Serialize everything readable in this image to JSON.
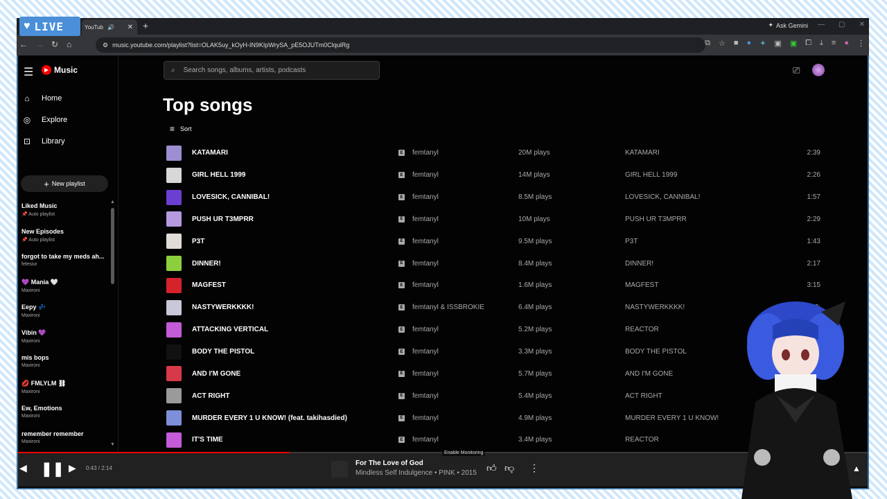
{
  "overlay": {
    "live_label": "LIVE"
  },
  "browser": {
    "tab_title": "YouTub",
    "url": "music.youtube.com/playlist?list=OLAK5uy_kOyH-IN9KIpWrySA_pE5OJUTm0ClqulRg",
    "ask_gemini": "Ask Gemini"
  },
  "app": {
    "brand": "Music",
    "search_placeholder": "Search songs, albums, artists, podcasts",
    "nav": [
      {
        "label": "Home",
        "icon": "home-icon"
      },
      {
        "label": "Explore",
        "icon": "explore-icon"
      },
      {
        "label": "Library",
        "icon": "library-icon"
      }
    ],
    "new_playlist_label": "New playlist",
    "playlists": [
      {
        "title": "Liked Music",
        "sub": "📌 Auto playlist"
      },
      {
        "title": "New Episodes",
        "sub": "📌 Auto playlist"
      },
      {
        "title": "forgot to take my meds ah...",
        "sub": "felesiur"
      },
      {
        "title": "💜 Mania 🤍",
        "sub": "Maxironi"
      },
      {
        "title": "Eepy 💤",
        "sub": "Maxironi"
      },
      {
        "title": "Vibin 💜",
        "sub": "Maxironi"
      },
      {
        "title": "mis bops",
        "sub": "Maxironi"
      },
      {
        "title": "💋 FMLYLM ⛓",
        "sub": "Maxironi"
      },
      {
        "title": "Ew, Emotions",
        "sub": "Maxironi"
      },
      {
        "title": "remember remember",
        "sub": "Maxironi"
      }
    ],
    "page_title": "Top songs",
    "sort_label": "Sort",
    "explicit_badge": "E",
    "songs": [
      {
        "title": "KATAMARI",
        "artist": "femtanyl",
        "plays": "20M plays",
        "album": "KATAMARI",
        "duration": "2:39",
        "color": "#9c8ed1"
      },
      {
        "title": "GIRL HELL 1999",
        "artist": "femtanyl",
        "plays": "14M plays",
        "album": "GIRL HELL 1999",
        "duration": "2:26",
        "color": "#d8d8d8"
      },
      {
        "title": "LOVESICK, CANNIBAL!",
        "artist": "femtanyl",
        "plays": "8.5M plays",
        "album": "LOVESICK, CANNIBAL!",
        "duration": "1:57",
        "color": "#6a3fd1"
      },
      {
        "title": "PUSH UR T3MPRR",
        "artist": "femtanyl",
        "plays": "10M plays",
        "album": "PUSH UR T3MPRR",
        "duration": "2:29",
        "color": "#b59adf"
      },
      {
        "title": "P3T",
        "artist": "femtanyl",
        "plays": "9.5M plays",
        "album": "P3T",
        "duration": "1:43",
        "color": "#e0dcd6"
      },
      {
        "title": "DINNER!",
        "artist": "femtanyl",
        "plays": "8.4M plays",
        "album": "DINNER!",
        "duration": "2:17",
        "color": "#8ccf3e"
      },
      {
        "title": "MAGFEST",
        "artist": "femtanyl",
        "plays": "1.6M plays",
        "album": "MAGFEST",
        "duration": "3:15",
        "color": "#d6222a"
      },
      {
        "title": "NASTYWERKKKK!",
        "artist": "femtanyl & ISSBROKIE",
        "plays": "6.4M plays",
        "album": "NASTYWERKKKK!",
        "duration": "2:",
        "color": "#c8c8d8"
      },
      {
        "title": "ATTACKING VERTICAL",
        "artist": "femtanyl",
        "plays": "5.2M plays",
        "album": "REACTOR",
        "duration": "",
        "color": "#c45bd8"
      },
      {
        "title": "BODY THE PISTOL",
        "artist": "femtanyl",
        "plays": "3.3M plays",
        "album": "BODY THE PISTOL",
        "duration": ":39",
        "color": "#111111"
      },
      {
        "title": "AND I'M GONE",
        "artist": "femtanyl",
        "plays": "5.7M plays",
        "album": "AND I'M GONE",
        "duration": "2:47",
        "color": "#d63a4a"
      },
      {
        "title": "ACT RIGHT",
        "artist": "femtanyl",
        "plays": "5.4M plays",
        "album": "ACT RIGHT",
        "duration": "",
        "color": "#9a9a9a"
      },
      {
        "title": "MURDER EVERY 1 U KNOW! (feat. takihasdied)",
        "artist": "femtanyl",
        "plays": "4.9M plays",
        "album": "MURDER EVERY 1 U KNOW!",
        "duration": "",
        "color": "#7d8fd8"
      },
      {
        "title": "IT'S TIME",
        "artist": "femtanyl",
        "plays": "3.4M plays",
        "album": "REACTOR",
        "duration": ":08",
        "color": "#c45bd8"
      }
    ]
  },
  "player": {
    "time": "0:43 / 2:14",
    "progress": 0.32,
    "now_playing_title": "For The Love of God",
    "now_playing_sub": "Mindless Self Indulgence • PINK • 2015",
    "tooltip": "Enable Monitoring"
  }
}
